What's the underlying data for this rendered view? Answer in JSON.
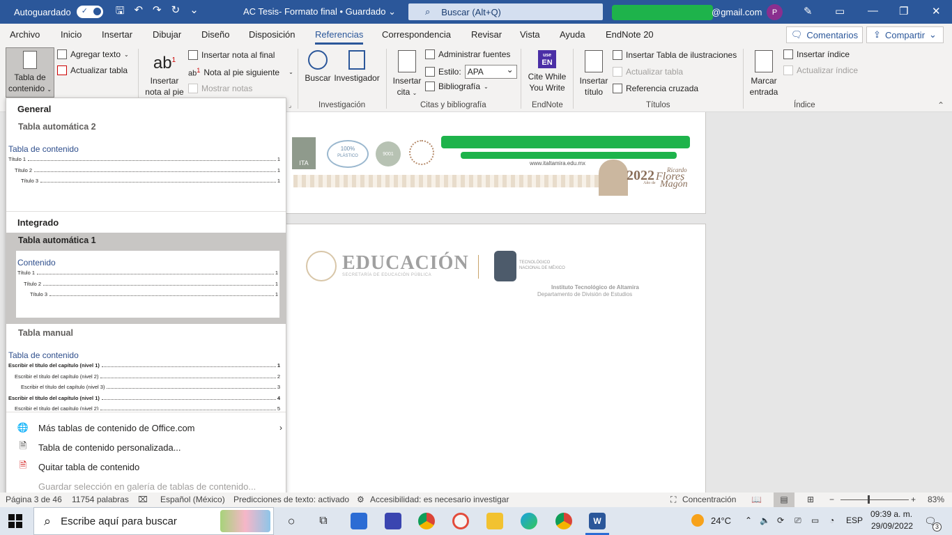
{
  "titlebar": {
    "autosave_label": "Autoguardado",
    "doc_title": "AC Tesis- Formato final • Guardado",
    "search_placeholder": "Buscar (Alt+Q)",
    "email_suffix": "@gmail.com",
    "avatar_initial": "P"
  },
  "menu": {
    "tabs": [
      "Archivo",
      "Inicio",
      "Insertar",
      "Dibujar",
      "Diseño",
      "Disposición",
      "Referencias",
      "Correspondencia",
      "Revisar",
      "Vista",
      "Ayuda",
      "EndNote 20"
    ],
    "active_tab": "Referencias",
    "comments": "Comentarios",
    "share": "Compartir"
  },
  "ribbon": {
    "toc": {
      "line1": "Tabla de",
      "line2": "contenido"
    },
    "add_text": "Agregar texto",
    "update_table": "Actualizar tabla",
    "insert_footnote": {
      "line1": "Insertar",
      "line2": "nota al pie"
    },
    "insert_endnote": "Insertar nota al final",
    "next_footnote": "Nota al pie siguiente",
    "show_notes": "Mostrar notas",
    "search": "Buscar",
    "researcher": "Investigador",
    "group_research": "Investigación",
    "insert_citation": {
      "line1": "Insertar",
      "line2": "cita"
    },
    "manage_sources": "Administrar fuentes",
    "style_label": "Estilo:",
    "style_value": "APA",
    "bibliography": "Bibliografía",
    "group_citations": "Citas y bibliografía",
    "cite_while": {
      "line1": "Cite While",
      "line2": "You Write"
    },
    "endnote_icon": {
      "line1": "use",
      "line2": "EN"
    },
    "group_endnote": "EndNote",
    "insert_caption": {
      "line1": "Insertar",
      "line2": "título"
    },
    "insert_table_figures": "Insertar Tabla de ilustraciones",
    "update_table_disabled": "Actualizar tabla",
    "cross_reference": "Referencia cruzada",
    "group_captions": "Títulos",
    "mark_entry": {
      "line1": "Marcar",
      "line2": "entrada"
    },
    "insert_index": "Insertar índice",
    "update_index": "Actualizar índice",
    "group_index": "Índice"
  },
  "document": {
    "website": "www.italtamira.edu.mx",
    "year": "2022",
    "ricardo": "Ricardo",
    "flores": "Flores",
    "magon": "Magón",
    "anio_de": "Año de",
    "logo_100": "100%",
    "logo_plastico": "PLÁSTICO",
    "logo_9001": "9001",
    "logo_ita": "ITA",
    "edu_title": "EDUCACIÓN",
    "edu_sub": "SECRETARÍA DE EDUCACIÓN PÚBLICA",
    "tec_line1": "TECNOLÓGICO",
    "tec_line2": "NACIONAL DE MÉXICO",
    "institute": "Instituto Tecnológico de Altamira",
    "department": "Departamento de División de Estudios"
  },
  "dropdown": {
    "section_general": "General",
    "auto2": {
      "title": "Tabla automática 2",
      "heading": "Tabla de contenido",
      "lines": [
        {
          "label": "Título 1",
          "num": "1"
        },
        {
          "label": "Título 2",
          "num": "1"
        },
        {
          "label": "Título 3",
          "num": "1"
        }
      ]
    },
    "section_integrated": "Integrado",
    "auto1": {
      "title": "Tabla automática 1",
      "heading": "Contenido",
      "lines": [
        {
          "label": "Título 1",
          "num": "1"
        },
        {
          "label": "Título 2",
          "num": "1"
        },
        {
          "label": "Título 3",
          "num": "1"
        }
      ]
    },
    "manual": {
      "title": "Tabla manual",
      "heading": "Tabla de contenido",
      "lines": [
        {
          "label": "Escribir el título del capítulo (nivel 1)",
          "num": "1"
        },
        {
          "label": "Escribir el título del capítulo (nivel 2)",
          "num": "2"
        },
        {
          "label": "Escribir el título del capítulo (nivel 3)",
          "num": "3"
        },
        {
          "label": "Escribir el título del capítulo (nivel 1)",
          "num": "4"
        },
        {
          "label": "Escribir el título del capítulo (nivel 2)",
          "num": "5"
        }
      ]
    },
    "commands": {
      "more_office": "Más tablas de contenido de Office.com",
      "custom": "Tabla de contenido personalizada...",
      "remove": "Quitar tabla de contenido",
      "save_selection": "Guardar selección en galería de tablas de contenido..."
    }
  },
  "status": {
    "page": "Página 3 de 46",
    "words": "11754 palabras",
    "language": "Español (México)",
    "predictions": "Predicciones de texto: activado",
    "accessibility": "Accesibilidad: es necesario investigar",
    "focus": "Concentración",
    "zoom": "83%",
    "zoom_level": 0.83
  },
  "taskbar": {
    "search_placeholder": "Escribe aquí para buscar",
    "weather": "24°C",
    "lang": "ESP",
    "time": "09:39 a. m.",
    "date": "29/09/2022",
    "notifications": "3"
  },
  "colors": {
    "word_blue": "#2b579a",
    "redaction_green": "#1eb34b",
    "selected_gallery": "#c8c6c4"
  }
}
